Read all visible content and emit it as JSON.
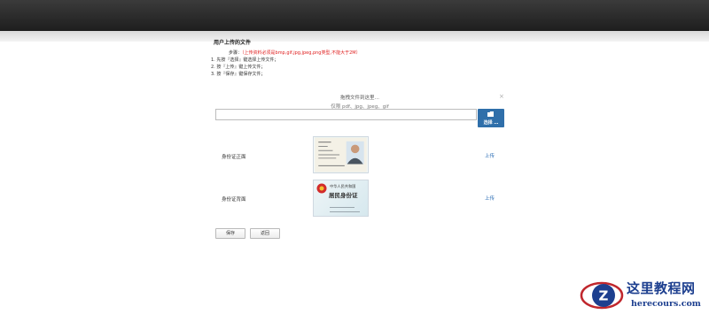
{
  "header": {},
  "page": {
    "title": "用户上传的文件"
  },
  "instructions": {
    "step_label": "步骤：",
    "note": "（上传资料必须是bmp,gif,jpg,jpeg,png类型,不能大于2M）",
    "steps": [
      "1. 先按『选择』键选择上传文件；",
      "2. 按『上传』键上传文件；",
      "3. 按『保存』键保存文件；"
    ]
  },
  "dropzone": {
    "title": "拖拽文件到这里…",
    "formats": "仅限 pdf、jpg、jpeg、gif",
    "close": "×"
  },
  "file_input": {
    "value": ""
  },
  "choose_button": {
    "label": "选择 …"
  },
  "documents": [
    {
      "label": "身份证正面",
      "upload": "上传",
      "image": "id-card-front"
    },
    {
      "label": "身份证背面",
      "upload": "上传",
      "image": "id-card-back"
    }
  ],
  "id_back_text": {
    "country": "中华人民共和国",
    "title": "居民身份证"
  },
  "actions": {
    "save": "保存",
    "back": "返回"
  },
  "watermark": {
    "title": "这里教程网",
    "url": "herecours.com",
    "logo_letter": "Z"
  },
  "colors": {
    "accent": "#2f6faa",
    "note_red": "#e02020",
    "link": "#2a6db5",
    "watermark": "#1d3f8f"
  }
}
